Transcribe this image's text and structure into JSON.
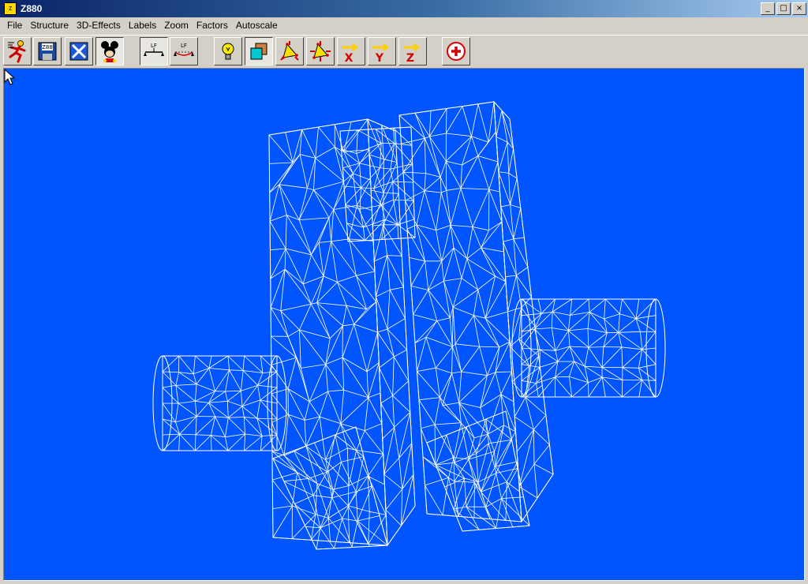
{
  "window": {
    "title": "Z880"
  },
  "menu": [
    "File",
    "Structure",
    "3D-Effects",
    "Labels",
    "Zoom",
    "Factors",
    "Autoscale"
  ],
  "toolbar": {
    "buttons": [
      {
        "name": "exit-button",
        "icon": "runner-icon"
      },
      {
        "name": "save-button",
        "icon": "floppy-icon",
        "label": "Z88"
      },
      {
        "name": "close-structure-button",
        "icon": "x-box-icon"
      },
      {
        "name": "help-button",
        "icon": "mouse-icon"
      },
      {
        "name": "undeformed-button",
        "icon": "undeformed-icon",
        "label": "LF"
      },
      {
        "name": "deformed-button",
        "icon": "deformed-icon",
        "label": "LF"
      },
      {
        "name": "light-button",
        "icon": "bulb-icon"
      },
      {
        "name": "solid-button",
        "icon": "cubes-icon"
      },
      {
        "name": "rotate-button",
        "icon": "rotate-icon"
      },
      {
        "name": "pan-button",
        "icon": "pan-icon"
      },
      {
        "name": "rotate-x-button",
        "icon": "x-arrow-icon",
        "label": "X"
      },
      {
        "name": "rotate-y-button",
        "icon": "y-arrow-icon",
        "label": "Y"
      },
      {
        "name": "rotate-z-button",
        "icon": "z-arrow-icon",
        "label": "Z"
      },
      {
        "name": "zoom-in-button",
        "icon": "plus-circle-icon"
      }
    ]
  },
  "colors": {
    "viewport_bg": "#0055ff",
    "wire": "#ffffff",
    "titlebar": "#0a246a"
  }
}
